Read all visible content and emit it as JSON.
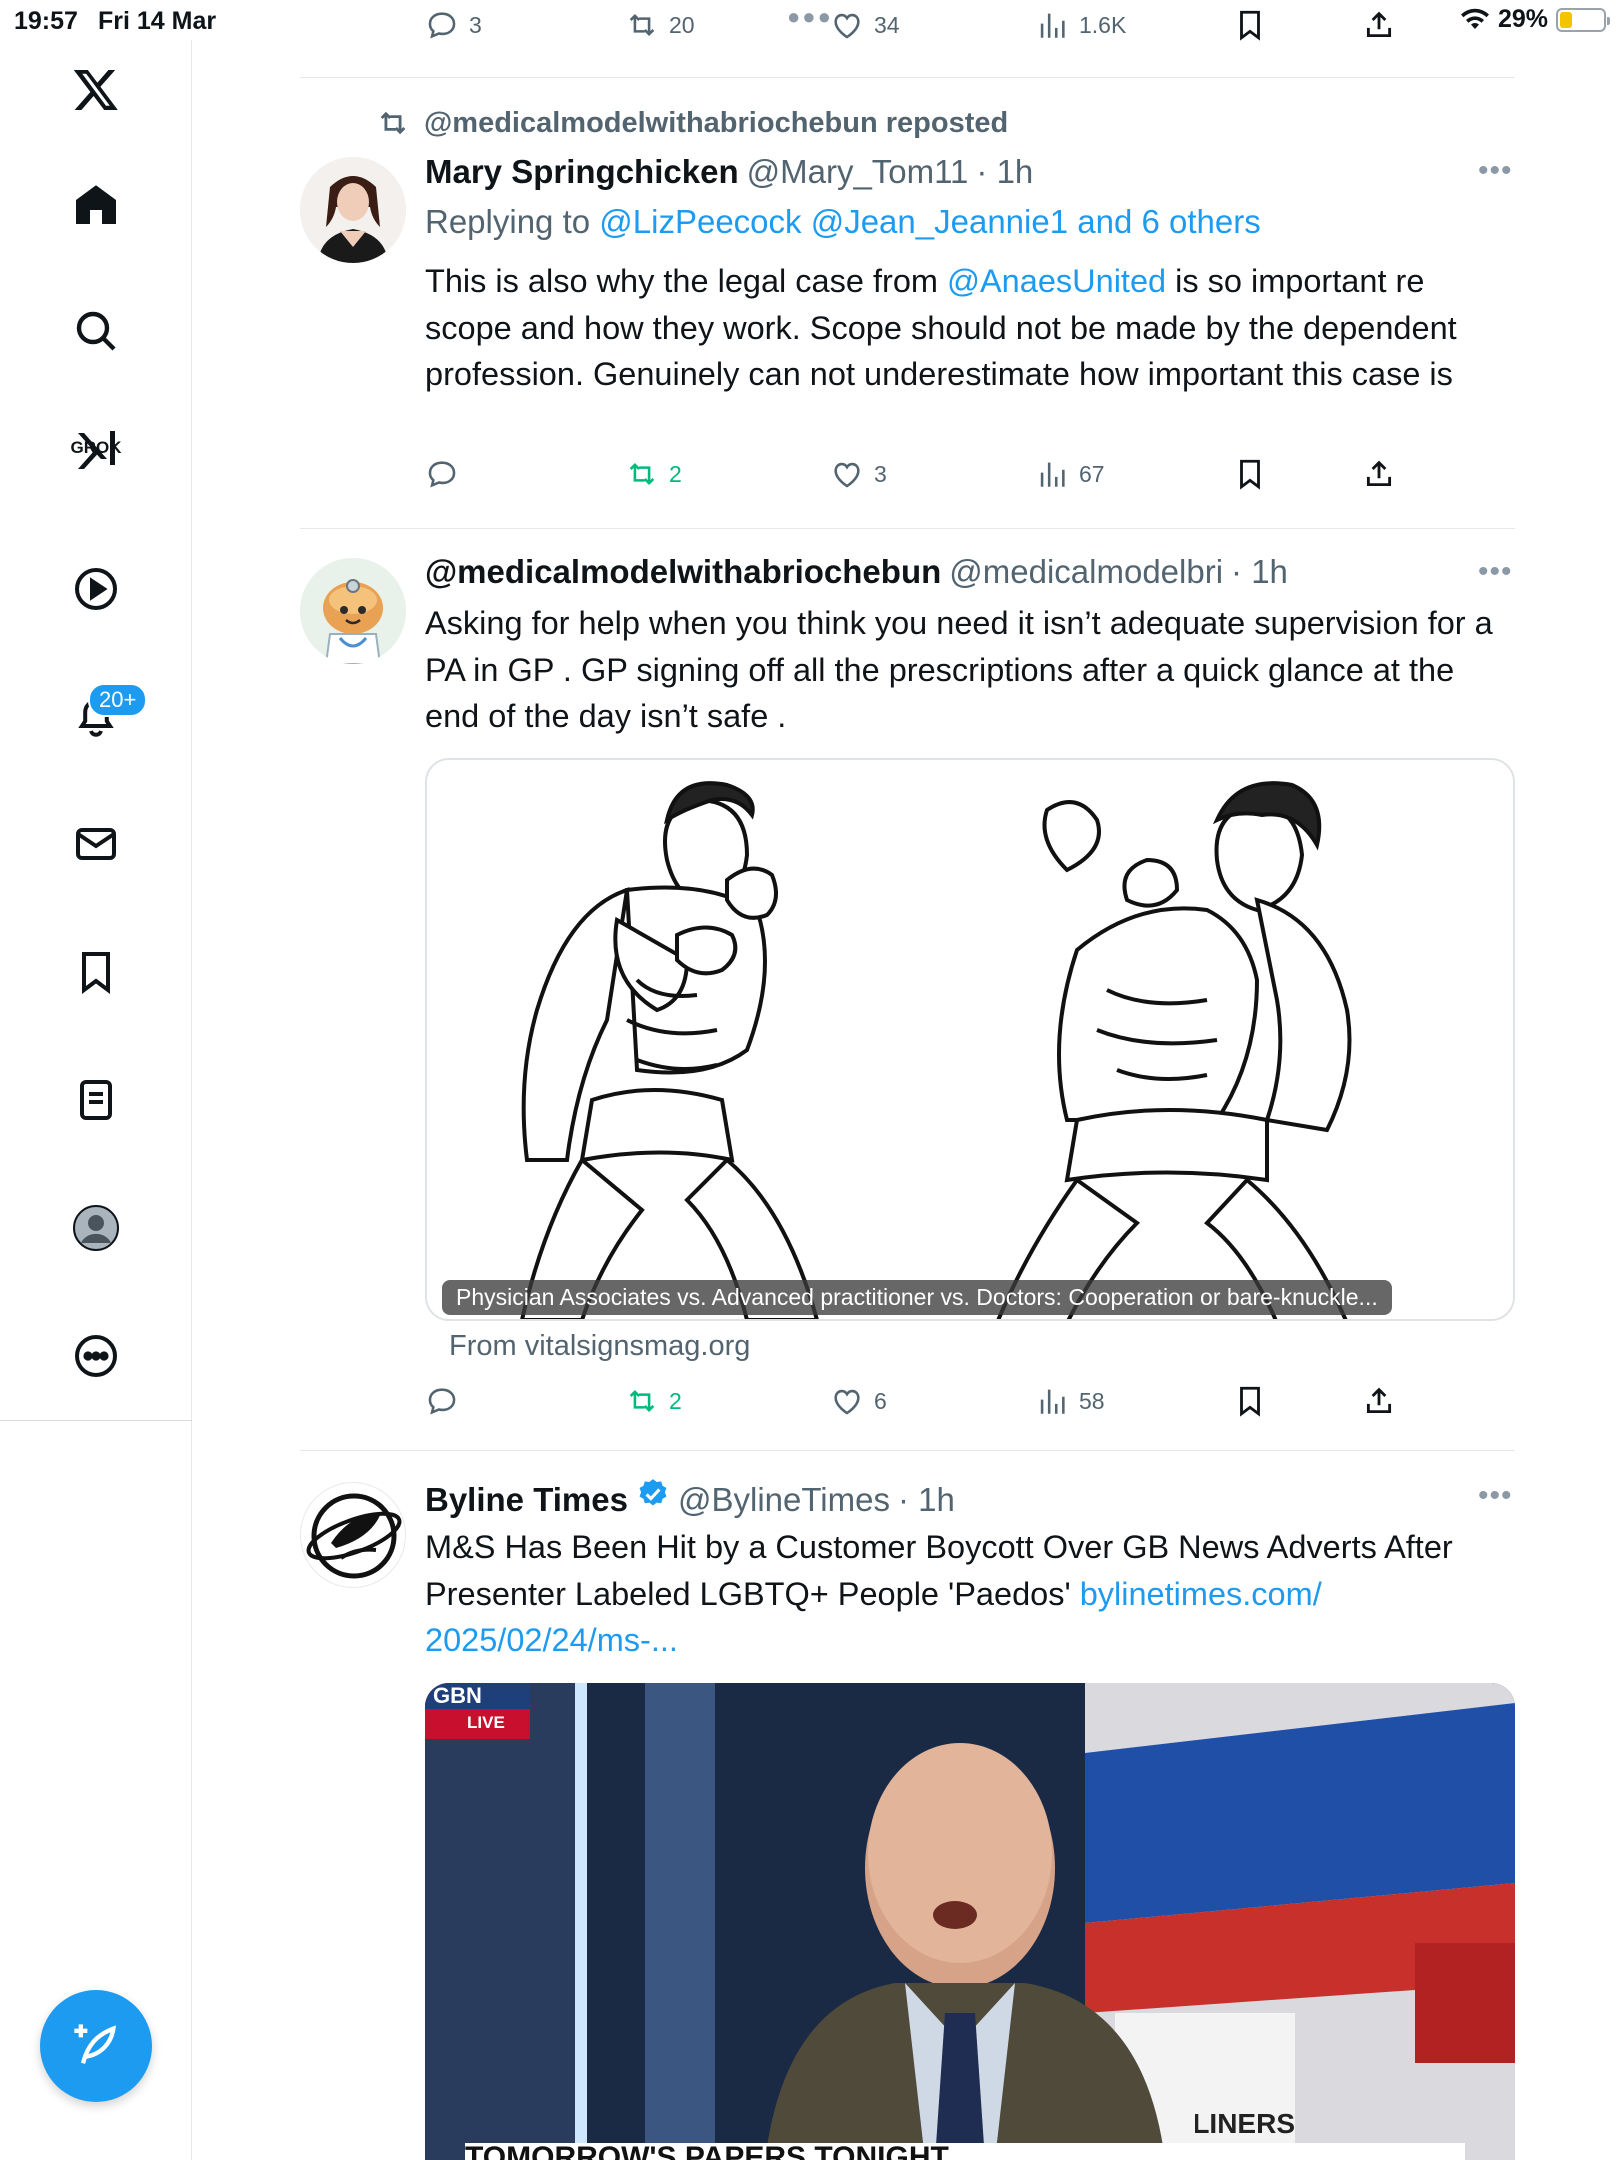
{
  "status_bar": {
    "time": "19:57",
    "date": "Fri 14 Mar",
    "battery": "29%",
    "battery_level": 0.29
  },
  "sidebar": {
    "badge": "20+",
    "grok_label": "GROK"
  },
  "top_actions": {
    "replies": "3",
    "reposts": "20",
    "likes": "34",
    "views": "1.6K"
  },
  "tweet1": {
    "reposted_by": "@medicalmodelwithabriochebun reposted",
    "name": "Mary Springchicken",
    "handle": "@Mary_Tom11",
    "time": "· 1h",
    "replying_prefix": "Replying to",
    "replying_users": "@LizPeecock @Jean_Jeannie1 and 6 others",
    "text_before": "This is also why the legal case from ",
    "text_link": "@AnaesUnited",
    "text_after": " is so important re scope and how they work. Scope should not be made by the dependent profession. Genuinely can not underestimate how important this case is",
    "replies": "",
    "reposts": "2",
    "likes": "3",
    "views": "67"
  },
  "tweet2": {
    "name": "@medicalmodelwithabriochebun",
    "handle": "@medicalmodelbri",
    "time": "· 1h",
    "text": "Asking for help when you think you need it isn’t adequate supervision for a PA in GP . GP signing off all the prescriptions after a quick glance at the end of the day isn’t safe .",
    "card_title": "Physician Associates vs. Advanced practitioner vs. Doctors: Cooperation or bare-knuckle...",
    "card_source": "From vitalsignsmag.org",
    "replies": "",
    "reposts": "2",
    "likes": "6",
    "views": "58"
  },
  "tweet3": {
    "name": "Byline Times",
    "handle": "@BylineTimes",
    "time": "· 1h",
    "text": "M&S Has Been Hit by a Customer Boycott Over GB News Adverts After Presenter Labeled LGBTQ+ People 'Paedos' ",
    "link": "bylinetimes.com/ 2025/02/24/ms-...",
    "media_live": "LIVE",
    "media_logo": "GBN",
    "media_banner": "TOMORROW'S PAPERS TONIGHT",
    "media_headliners": "HEADLINERS"
  },
  "colors": {
    "accent": "#1d9bf0",
    "repost_green": "#00ba7c",
    "muted": "#536471"
  }
}
